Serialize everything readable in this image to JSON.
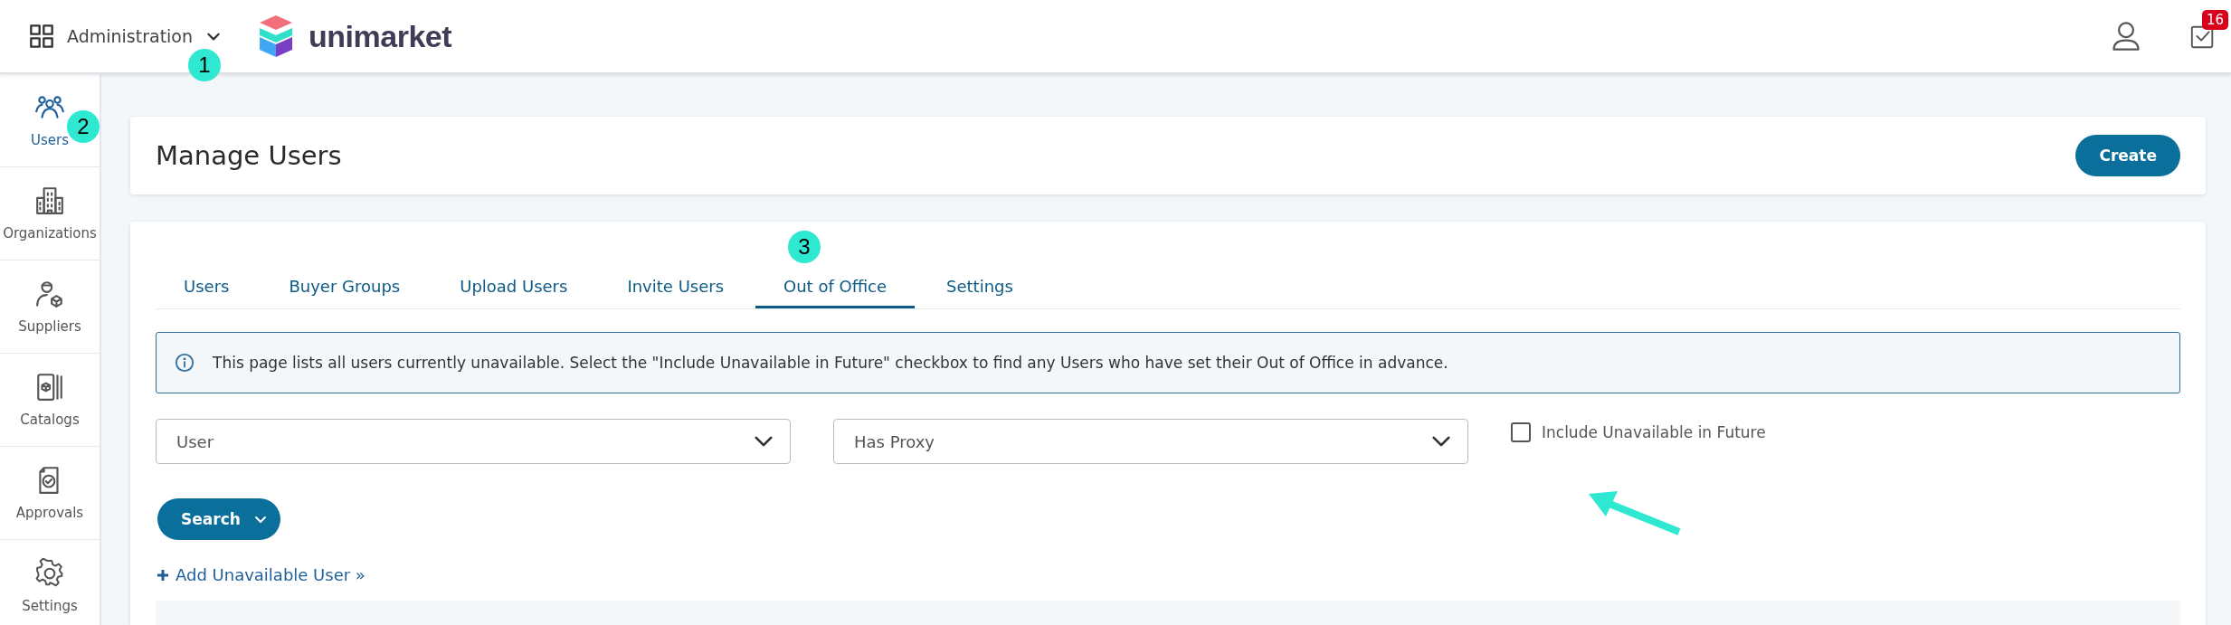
{
  "header": {
    "app_menu": "Administration",
    "brand": "unimarket",
    "notification_count": "16"
  },
  "sidebar": {
    "items": [
      {
        "label": "Users",
        "selected": true
      },
      {
        "label": "Organizations",
        "selected": false
      },
      {
        "label": "Suppliers",
        "selected": false
      },
      {
        "label": "Catalogs",
        "selected": false
      },
      {
        "label": "Approvals",
        "selected": false
      },
      {
        "label": "Settings",
        "selected": false
      }
    ]
  },
  "page": {
    "title": "Manage Users",
    "create_button": "Create"
  },
  "tabs": [
    {
      "label": "Users",
      "selected": false
    },
    {
      "label": "Buyer Groups",
      "selected": false
    },
    {
      "label": "Upload Users",
      "selected": false
    },
    {
      "label": "Invite Users",
      "selected": false
    },
    {
      "label": "Out of Office",
      "selected": true
    },
    {
      "label": "Settings",
      "selected": false
    }
  ],
  "info": "This page lists all users currently unavailable. Select the \"Include Unavailable in Future\" checkbox to find any Users who have set their Out of Office in advance.",
  "filters": {
    "user": {
      "placeholder": "User"
    },
    "proxy": {
      "placeholder": "Has Proxy"
    },
    "include_future": {
      "label": "Include Unavailable in Future",
      "checked": false
    }
  },
  "search_button": "Search",
  "add_link": "Add Unavailable User »",
  "annotations": [
    "1",
    "2",
    "3"
  ]
}
